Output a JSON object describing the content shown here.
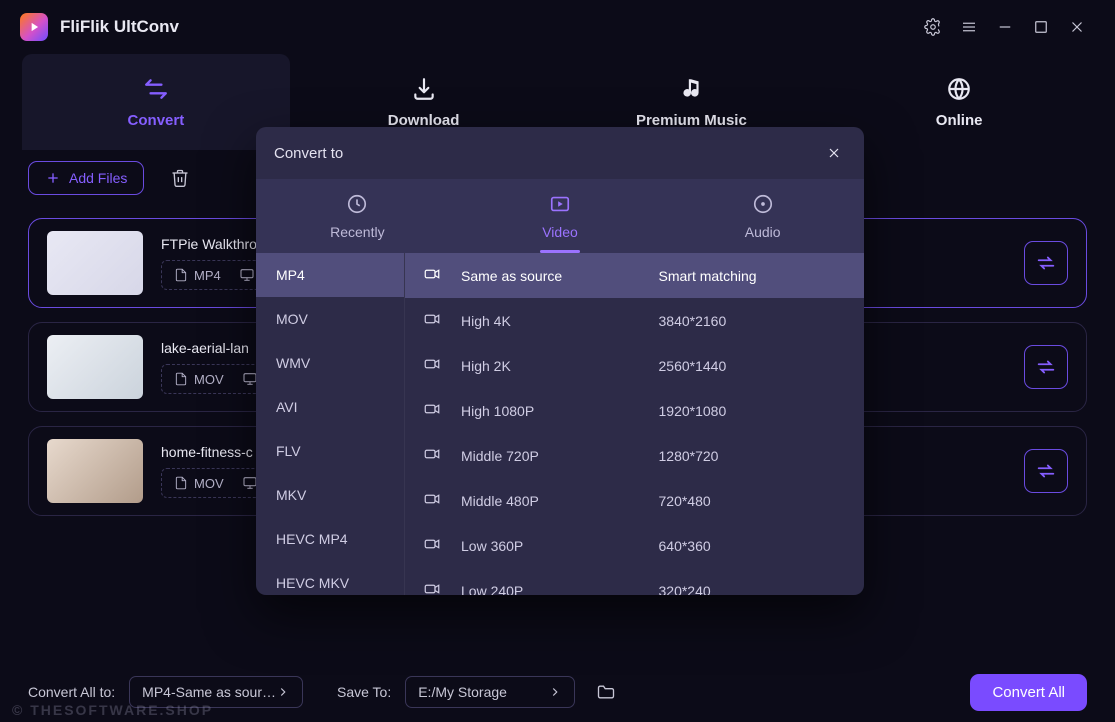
{
  "app": {
    "title": "FliFlik UltConv"
  },
  "nav": [
    {
      "label": "Convert",
      "icon": "convert",
      "active": true
    },
    {
      "label": "Download",
      "icon": "download",
      "active": false
    },
    {
      "label": "Premium Music",
      "icon": "music",
      "active": false
    },
    {
      "label": "Online",
      "icon": "globe",
      "active": false
    }
  ],
  "toolbar": {
    "add_label": "Add Files"
  },
  "files": [
    {
      "name": "FTPie Walkthro",
      "fmt": "MP4",
      "selected": true,
      "thumb": "t1"
    },
    {
      "name": "lake-aerial-lan",
      "fmt": "MOV",
      "selected": false,
      "thumb": "t2"
    },
    {
      "name": "home-fitness-c",
      "fmt": "MOV",
      "selected": false,
      "thumb": "t3"
    }
  ],
  "bottom": {
    "convert_all_to_label": "Convert All to:",
    "convert_all_value": "MP4-Same as sour…",
    "save_to_label": "Save To:",
    "save_to_value": "E:/My Storage",
    "convert_all_btn": "Convert All"
  },
  "popup": {
    "title": "Convert to",
    "tabs": [
      {
        "label": "Recently",
        "icon": "clock",
        "active": false
      },
      {
        "label": "Video",
        "icon": "video",
        "active": true
      },
      {
        "label": "Audio",
        "icon": "audio",
        "active": false
      }
    ],
    "formats": [
      {
        "name": "MP4",
        "selected": true
      },
      {
        "name": "MOV",
        "selected": false
      },
      {
        "name": "WMV",
        "selected": false
      },
      {
        "name": "AVI",
        "selected": false
      },
      {
        "name": "FLV",
        "selected": false
      },
      {
        "name": "MKV",
        "selected": false
      },
      {
        "name": "HEVC MP4",
        "selected": false
      },
      {
        "name": "HEVC MKV",
        "selected": false
      }
    ],
    "presets": [
      {
        "label": "Same as source",
        "res": "Smart matching",
        "selected": true
      },
      {
        "label": "High 4K",
        "res": "3840*2160",
        "selected": false
      },
      {
        "label": "High 2K",
        "res": "2560*1440",
        "selected": false
      },
      {
        "label": "High 1080P",
        "res": "1920*1080",
        "selected": false
      },
      {
        "label": "Middle 720P",
        "res": "1280*720",
        "selected": false
      },
      {
        "label": "Middle 480P",
        "res": "720*480",
        "selected": false
      },
      {
        "label": "Low 360P",
        "res": "640*360",
        "selected": false
      },
      {
        "label": "Low 240P",
        "res": "320*240",
        "selected": false
      }
    ]
  },
  "watermark": "© THESOFTWARE.SHOP"
}
